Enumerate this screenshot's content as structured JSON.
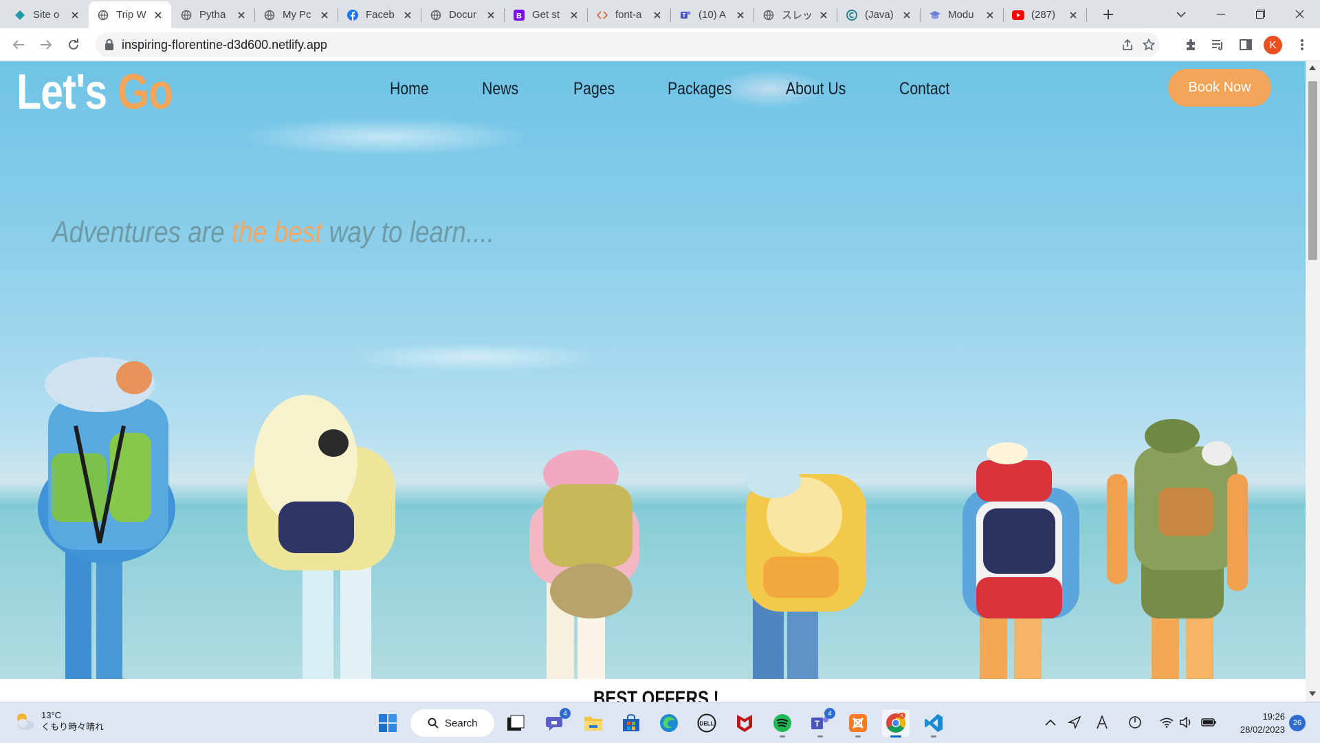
{
  "browser": {
    "tabs": [
      {
        "title": "Site o",
        "icon": "netlify-diamond-icon",
        "active": false
      },
      {
        "title": "Trip W",
        "icon": "globe-icon",
        "active": true
      },
      {
        "title": "Pytha",
        "icon": "globe-icon",
        "active": false
      },
      {
        "title": "My Pc",
        "icon": "globe-icon",
        "active": false
      },
      {
        "title": "Faceb",
        "icon": "facebook-icon",
        "active": false
      },
      {
        "title": "Docur",
        "icon": "globe-icon",
        "active": false
      },
      {
        "title": "Get st",
        "icon": "bootstrap-icon",
        "active": false
      },
      {
        "title": "font-a",
        "icon": "code-icon",
        "active": false
      },
      {
        "title": "(10) A",
        "icon": "teams-icon",
        "active": false
      },
      {
        "title": "スレット",
        "icon": "globe-icon",
        "active": false
      },
      {
        "title": "(Java)",
        "icon": "circle-c-icon",
        "active": false
      },
      {
        "title": "Modu",
        "icon": "graduation-cap-icon",
        "active": false
      },
      {
        "title": "(287)",
        "icon": "youtube-icon",
        "active": false
      }
    ],
    "url": "inspiring-florentine-d3d600.netlify.app",
    "profile_initial": "K"
  },
  "site": {
    "logo_part1": "Let's",
    "logo_part2": "Go",
    "nav": [
      "Home",
      "News",
      "Pages",
      "Packages",
      "About Us",
      "Contact"
    ],
    "book_button": "Book Now",
    "tagline_part1": "Adventures are ",
    "tagline_highlight": "the best",
    "tagline_part2": " way to learn....",
    "section_heading": "BEST OFFERS !"
  },
  "colors": {
    "accent_orange": "#f4a55a",
    "sky_blue": "#8ccfea",
    "chrome_tabstrip": "#dee1e6",
    "taskbar": "#dde6f2"
  },
  "taskbar": {
    "weather_temp": "13°C",
    "weather_desc": "くもり時々晴れ",
    "search_label": "Search",
    "apps": [
      {
        "name": "start",
        "icon": "windows-start-icon"
      },
      {
        "name": "task-view",
        "icon": "task-view-icon"
      },
      {
        "name": "teams-chat",
        "icon": "teams-chat-icon",
        "badge": "4"
      },
      {
        "name": "file-explorer",
        "icon": "folder-icon"
      },
      {
        "name": "store",
        "icon": "store-icon"
      },
      {
        "name": "edge",
        "icon": "edge-icon"
      },
      {
        "name": "dell",
        "icon": "dell-icon"
      },
      {
        "name": "mcafee",
        "icon": "mcafee-icon"
      },
      {
        "name": "spotify",
        "icon": "spotify-icon"
      },
      {
        "name": "teams",
        "icon": "teams-icon",
        "badge": "4"
      },
      {
        "name": "xampp",
        "icon": "xampp-icon"
      },
      {
        "name": "chrome",
        "icon": "chrome-icon"
      },
      {
        "name": "vscode",
        "icon": "vscode-icon"
      }
    ],
    "time": "19:26",
    "date": "28/02/2023",
    "notifications": "26"
  }
}
